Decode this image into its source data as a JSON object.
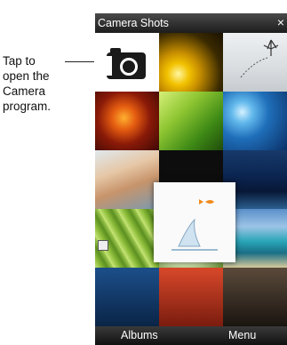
{
  "callout": {
    "lines": [
      "Tap to",
      "open the",
      "Camera",
      "program."
    ]
  },
  "app": {
    "title": "Camera Shots",
    "close_glyph": "×"
  },
  "grid": {
    "camera_tile_icon": "camera-icon",
    "photos": [
      "yellow-flower-photo",
      "winter-tree-photo",
      "orange-flower-photo",
      "green-leaf-photo",
      "blue-window-photo",
      "people-photo",
      "harbor-night-photo",
      "grass-photo",
      "white-flowers-photo",
      "beach-photo",
      "bottom-blue-photo",
      "bottom-red-photo",
      "bottom-dark-photo"
    ],
    "popup_photo": "fish-splash-photo"
  },
  "softkeys": {
    "left": "Albums",
    "right": "Menu"
  }
}
